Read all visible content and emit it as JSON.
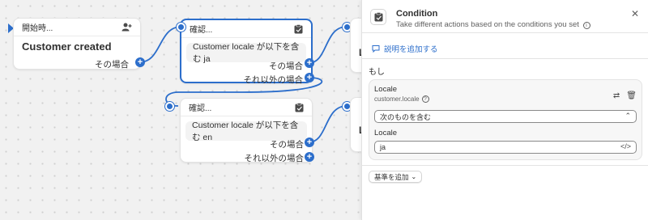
{
  "nodes": {
    "start": {
      "header": "開始時...",
      "event": "Customer created",
      "branch_then": "その場合",
      "icon": "person-add-icon"
    },
    "check1": {
      "header": "確認...",
      "condition": "Customer locale が以下を含む ja",
      "branch_then": "その場合",
      "branch_else": "それ以外の場合",
      "icon": "clipboard-check-icon"
    },
    "check2": {
      "header": "確認...",
      "condition": "Customer locale が以下を含む en",
      "branch_then": "その場合",
      "branch_else": "それ以外の場合",
      "icon": "clipboard-check-icon"
    }
  },
  "partial_nodes": {
    "a": "L",
    "b": "L"
  },
  "panel": {
    "title": "Condition",
    "subtitle": "Take different actions based on the conditions you set",
    "add_description": "説明を追加する",
    "if_label": "もし",
    "condition": {
      "field_label": "Locale",
      "field_path": "customer.locale",
      "operator": "次のものを含む",
      "value_label": "Locale",
      "value": "ja"
    },
    "add_criteria": "基準を追加"
  },
  "colors": {
    "accent": "#2c6ecb",
    "canvas_bg": "#f1f1f1"
  }
}
